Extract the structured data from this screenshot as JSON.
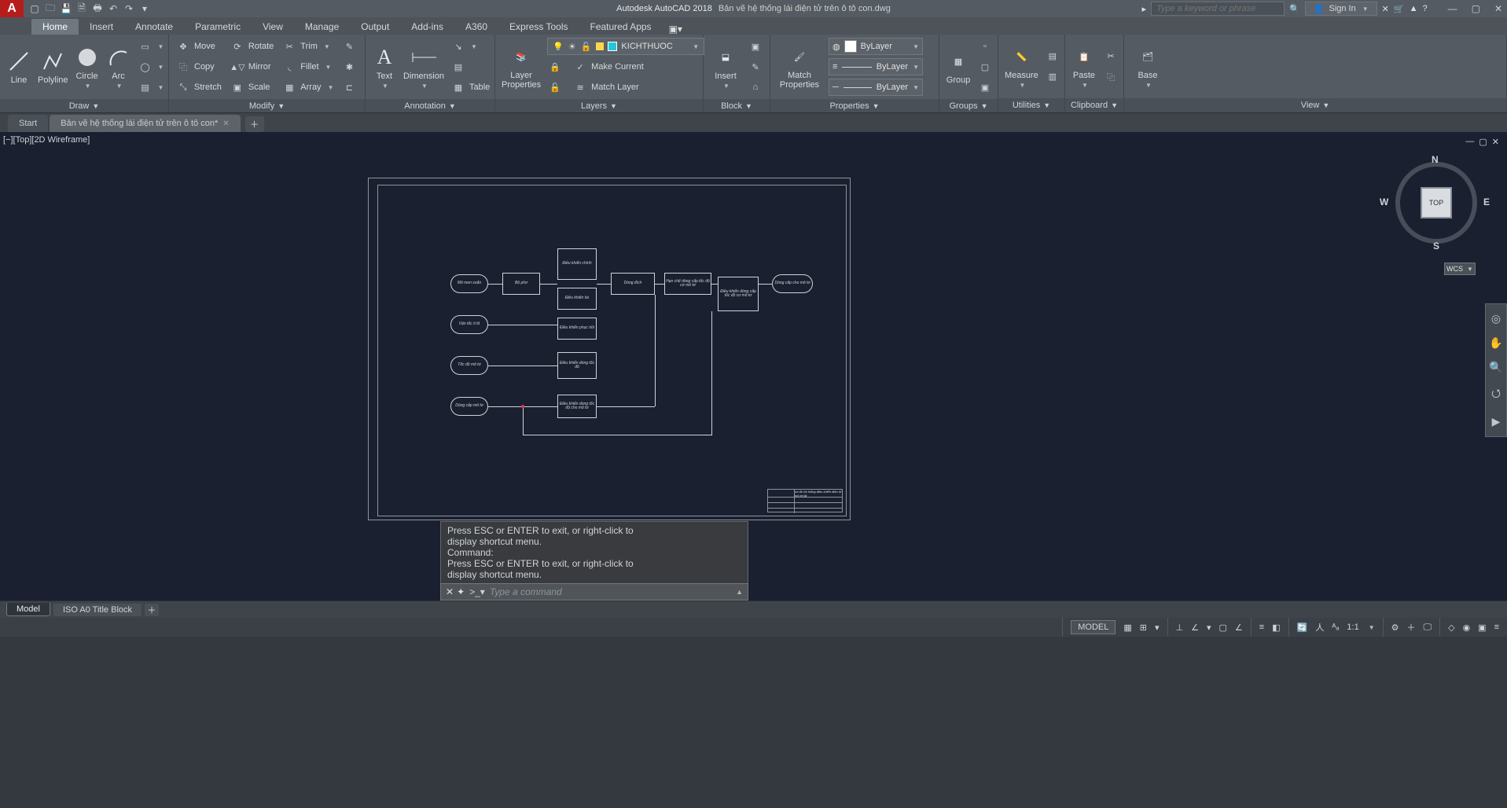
{
  "title": {
    "app": "Autodesk AutoCAD 2018",
    "doc": "Bản vẽ hệ thống lái điện tử trên ô tô con.dwg",
    "search_placeholder": "Type a keyword or phrase",
    "sign_in": "Sign In"
  },
  "ribbon_tabs": [
    "Home",
    "Insert",
    "Annotate",
    "Parametric",
    "View",
    "Manage",
    "Output",
    "Add-ins",
    "A360",
    "Express Tools",
    "Featured Apps"
  ],
  "ribbon_active": "Home",
  "panels": {
    "draw": {
      "title": "Draw",
      "items": [
        "Line",
        "Polyline",
        "Circle",
        "Arc"
      ]
    },
    "modify": {
      "title": "Modify",
      "items": [
        "Move",
        "Rotate",
        "Trim",
        "Copy",
        "Mirror",
        "Fillet",
        "Stretch",
        "Scale",
        "Array"
      ]
    },
    "annotation": {
      "title": "Annotation",
      "items": [
        "Text",
        "Dimension",
        "Table"
      ]
    },
    "layers": {
      "title": "Layers",
      "items": [
        "Layer Properties",
        "Make Current",
        "Match Layer"
      ],
      "combo": "KICHTHUOC"
    },
    "block": {
      "title": "Block",
      "items": [
        "Insert"
      ]
    },
    "properties": {
      "title": "Properties",
      "items": [
        "Match Properties"
      ],
      "combo1": "ByLayer",
      "combo2": "ByLayer",
      "combo3": "ByLayer"
    },
    "groups": {
      "title": "Groups",
      "items": [
        "Group"
      ]
    },
    "utilities": {
      "title": "Utilities",
      "items": [
        "Measure"
      ]
    },
    "clipboard": {
      "title": "Clipboard",
      "items": [
        "Paste"
      ]
    },
    "view": {
      "title": "View",
      "items": [
        "Base"
      ]
    }
  },
  "file_tabs": {
    "start": "Start",
    "active": "Bản vẽ hệ thống lái điện tử trên ô tô con*"
  },
  "viewport_label": "[−][Top][2D Wireframe]",
  "viewcube": {
    "face": "TOP",
    "n": "N",
    "e": "E",
    "s": "S",
    "w": "W",
    "wcs": "WCS"
  },
  "drawing": {
    "pills": [
      {
        "t": "Mô men xoắn"
      },
      {
        "t": "Vận tốc ô tô"
      },
      {
        "t": "Tốc độ mô tơ"
      },
      {
        "t": "Dòng cấp mô tơ"
      },
      {
        "t": "Dòng cấp cho mô tơ"
      }
    ],
    "rects": [
      {
        "t": "Bộ phơ"
      },
      {
        "t": "Điều khiển chính"
      },
      {
        "t": "Điều khiển bù"
      },
      {
        "t": "Điều khiển phục hồi"
      },
      {
        "t": "Điều khiển dòng tốc độ"
      },
      {
        "t": "Điều khiển dòng tốc độ cho mô tơ"
      },
      {
        "t": "Dòng đích"
      },
      {
        "t": "Hạn chế dòng cấp tốc độ cơ mô tơ"
      },
      {
        "t": "Điều khiển dòng cấp tốc độ cơ mô tơ"
      }
    ],
    "titleblock": "sơ đồ hệ thống\nđiều khiển điện tử\nmô tơ lái"
  },
  "cmd": {
    "history": [
      "Press ESC or ENTER to exit, or right-click to",
      "display shortcut menu.",
      "Command:",
      "Press ESC or ENTER to exit, or right-click to",
      "display shortcut menu."
    ],
    "placeholder": "Type a command"
  },
  "layout_tabs": {
    "active": "Model",
    "other": "ISO A0 Title Block"
  },
  "status": {
    "model": "MODEL",
    "scale": "1:1"
  }
}
